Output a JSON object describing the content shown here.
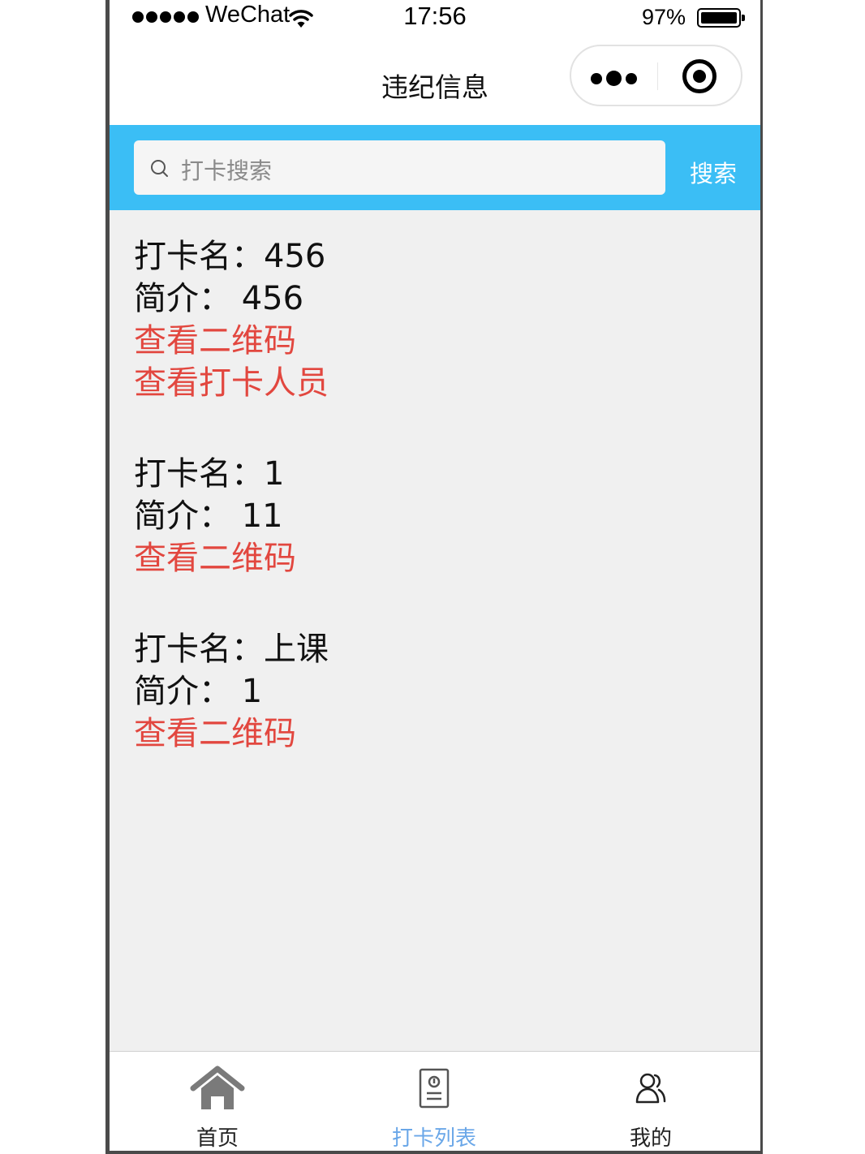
{
  "status_bar": {
    "carrier": "WeChat",
    "time": "17:56",
    "battery": "97%",
    "battery_level": 0.97
  },
  "nav": {
    "title": "违纪信息",
    "more_icon": "more-dots-icon",
    "close_icon": "target-icon"
  },
  "search": {
    "placeholder": "打卡搜索",
    "button_label": "搜索"
  },
  "records": [
    {
      "name_line": "打卡名：456",
      "intro_line": "简介： 456",
      "links": [
        "查看二维码",
        "查看打卡人员"
      ]
    },
    {
      "name_line": "打卡名：1",
      "intro_line": "简介： 11",
      "links": [
        "查看二维码"
      ]
    },
    {
      "name_line": "打卡名：上课",
      "intro_line": "简介： 1",
      "links": [
        "查看二维码"
      ]
    }
  ],
  "tabs": [
    {
      "label": "首页",
      "icon": "home-icon",
      "active": false
    },
    {
      "label": "打卡列表",
      "icon": "document-icon",
      "active": true
    },
    {
      "label": "我的",
      "icon": "users-icon",
      "active": false
    }
  ],
  "colors": {
    "search_bar_bg": "#3bbef5",
    "link_red": "#e2473f",
    "active_tab": "#6aa7e8"
  }
}
